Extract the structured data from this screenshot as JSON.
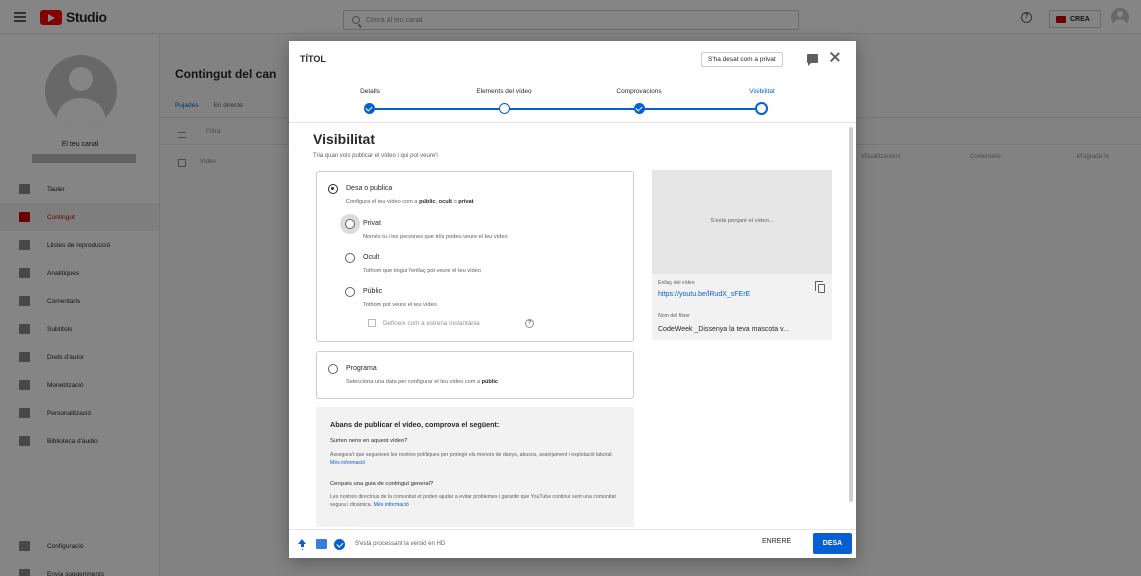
{
  "topbar": {
    "app_name": "Studio",
    "search_placeholder": "Cerca al teu canal",
    "help_symbol": "?",
    "create_label": "CREA"
  },
  "sidebar": {
    "channel_label": "El teu canal",
    "items": [
      {
        "label": "Tauler",
        "icon": "dashboard-icon"
      },
      {
        "label": "Contingut",
        "icon": "content-icon",
        "active": true
      },
      {
        "label": "Llistes de reproducció",
        "icon": "playlist-icon"
      },
      {
        "label": "Analítiques",
        "icon": "analytics-icon"
      },
      {
        "label": "Comentaris",
        "icon": "comments-icon"
      },
      {
        "label": "Subtítols",
        "icon": "subtitles-icon"
      },
      {
        "label": "Drets d'autor",
        "icon": "copyright-icon"
      },
      {
        "label": "Monetització",
        "icon": "monetization-icon"
      },
      {
        "label": "Personalització",
        "icon": "customization-icon"
      },
      {
        "label": "Biblioteca d'àudio",
        "icon": "audio-library-icon"
      },
      {
        "label": "Configuració",
        "icon": "settings-icon"
      },
      {
        "label": "Envia suggeriments",
        "icon": "feedback-icon"
      }
    ]
  },
  "main": {
    "title": "Contingut del can",
    "tabs": [
      "Pujades",
      "En directe"
    ],
    "filter_label": "Filtra",
    "video_column": "Vídeo",
    "columns": [
      "Visualitzacions",
      "Comentaris",
      "M'agrada %"
    ]
  },
  "dialog": {
    "title": "TÍTOL",
    "saved_chip": "S'ha desat com a privat",
    "steps": [
      {
        "label": "Detalls",
        "state": "done"
      },
      {
        "label": "Elements del vídeo",
        "state": "open"
      },
      {
        "label": "Comprovacions",
        "state": "done"
      },
      {
        "label": "Visibilitat",
        "state": "current"
      }
    ],
    "heading": "Visibilitat",
    "subheading": "Tria quan vols publicar el vídeo i qui pot veure'l",
    "save_publish": {
      "title": "Desa o publica",
      "desc_prefix": "Configura el teu vídeo com a ",
      "desc_public": "públic",
      "desc_sep1": ", ",
      "desc_unlisted": "ocult",
      "desc_sep2": " o ",
      "desc_private": "privat",
      "options": [
        {
          "title": "Privat",
          "desc": "Només tu i les persones que triïs podeu veure el teu vídeo"
        },
        {
          "title": "Ocult",
          "desc": "Tothom que tingui l'enllaç pot veure el teu vídeo"
        },
        {
          "title": "Públic",
          "desc": "Tothom pot veure el teu vídeo"
        }
      ],
      "premiere_label": "Defineix com a estrena instantània",
      "help_symbol": "?"
    },
    "schedule": {
      "title": "Programa",
      "desc_prefix": "Selecciona una data per configurar el teu vídeo com a ",
      "desc_bold": "públic"
    },
    "checklist": {
      "title": "Abans de publicar el vídeo, comprova el següent:",
      "q1": "Surten nens en aquest vídeo?",
      "p1": "Assegura't que segueixes les nostres polítiques per protegir els menors de danys, abusos, assetjament i explotació laboral.",
      "p1_link": "Més informació",
      "q2": "Cerques una guia de contingut general?",
      "p2": "Les nostres directrius de la comunitat et poden ajudar a evitar problemes i garantir que YouTube continuï sent una comunitat segura i dinàmica.",
      "p2_link": "Més informació"
    },
    "preview": {
      "uploading": "S'està penjant el vídeo...",
      "link_label": "Enllaç del vídeo",
      "link": "https://youtu.be/lRudX_sFErE",
      "file_label": "Nom del fitxer",
      "file_name": "CodeWeek _Dissenya la teva mascota v..."
    },
    "footer": {
      "status": "S'està processant la versió en HD",
      "back_label": "ENRERE",
      "save_label": "DESA"
    }
  },
  "colors": {
    "accent": "#065fd4",
    "brand": "#ff0000",
    "active_nav": "#cc0000"
  }
}
